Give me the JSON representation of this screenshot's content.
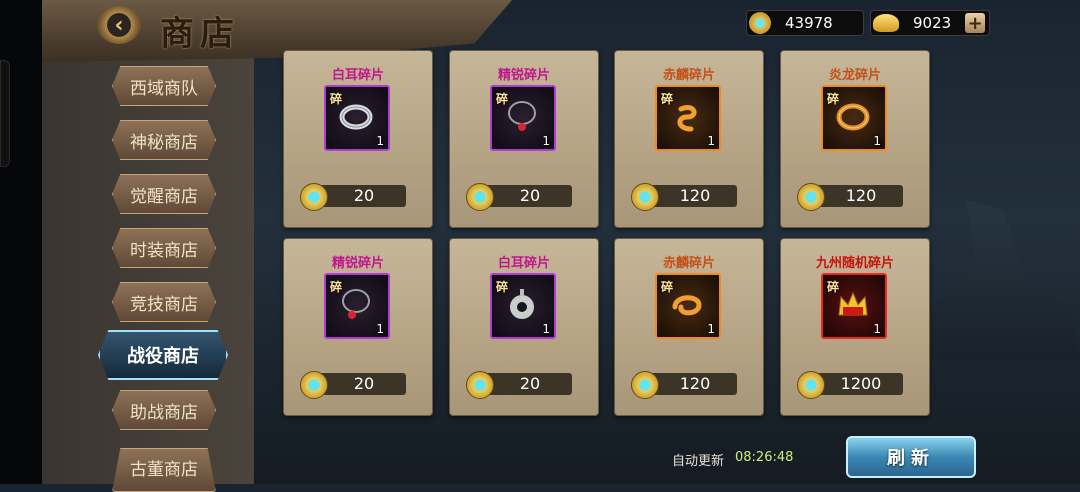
{
  "header": {
    "title": "商店",
    "back_label": "‹"
  },
  "currency": {
    "gems": "43978",
    "gold": "9023",
    "plus_label": "+"
  },
  "sidebar": {
    "tabs": [
      {
        "label": "西域商队"
      },
      {
        "label": "神秘商店"
      },
      {
        "label": "觉醒商店"
      },
      {
        "label": "时装商店"
      },
      {
        "label": "竞技商店"
      },
      {
        "label": "战役商店",
        "active": true
      },
      {
        "label": "助战商店"
      },
      {
        "label": "古董商店"
      }
    ]
  },
  "shop_items": [
    {
      "name": "白耳碎片",
      "count": "1",
      "price": "20",
      "frag": "碎",
      "rarity": "purple"
    },
    {
      "name": "精锐碎片",
      "count": "1",
      "price": "20",
      "frag": "碎",
      "rarity": "purple"
    },
    {
      "name": "赤麟碎片",
      "count": "1",
      "price": "120",
      "frag": "碎",
      "rarity": "orange"
    },
    {
      "name": "炎龙碎片",
      "count": "1",
      "price": "120",
      "frag": "碎",
      "rarity": "orange"
    },
    {
      "name": "精锐碎片",
      "count": "1",
      "price": "20",
      "frag": "碎",
      "rarity": "purple"
    },
    {
      "name": "白耳碎片",
      "count": "1",
      "price": "20",
      "frag": "碎",
      "rarity": "purple"
    },
    {
      "name": "赤麟碎片",
      "count": "1",
      "price": "120",
      "frag": "碎",
      "rarity": "orange"
    },
    {
      "name": "九州随机碎片",
      "count": "1",
      "price": "1200",
      "frag": "碎",
      "rarity": "red"
    }
  ],
  "footer": {
    "auto_refresh_label": "自动更新",
    "timer": "08:26:48",
    "refresh_button": "刷新"
  }
}
